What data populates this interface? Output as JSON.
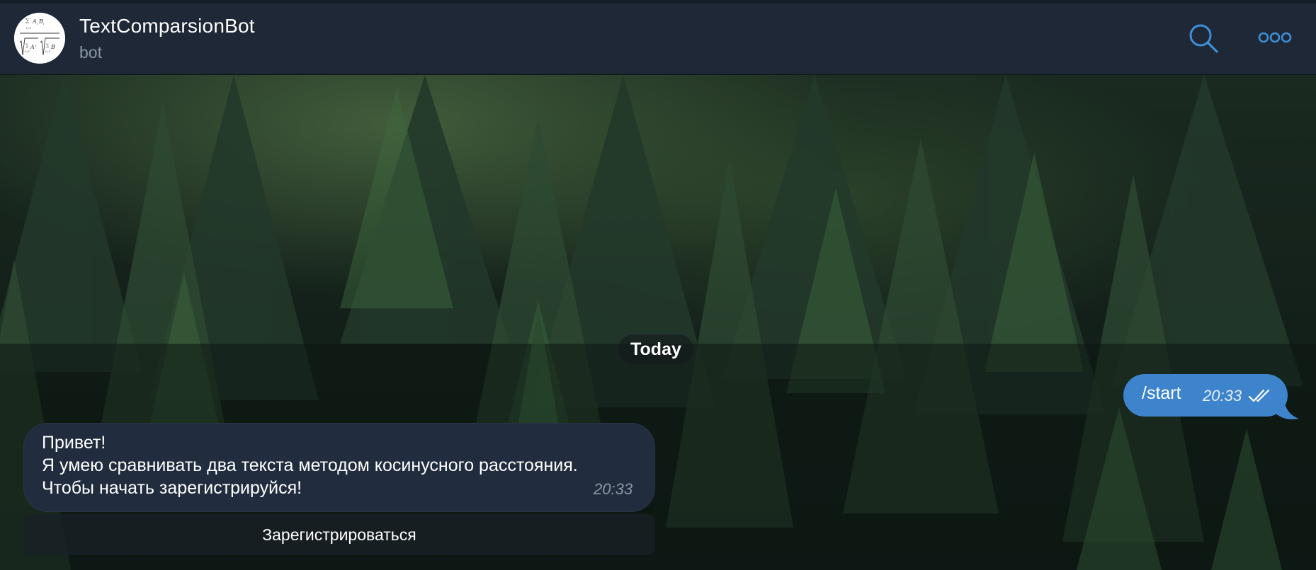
{
  "header": {
    "title": "TextComparsionBot",
    "status": "bot",
    "icons": [
      "bot-avatar",
      "search-icon",
      "more-icon"
    ]
  },
  "chat": {
    "date_label": "Today",
    "messages": [
      {
        "direction": "outgoing",
        "text": "/start",
        "time": "20:33",
        "status_icon": "double-check-icon"
      },
      {
        "direction": "incoming",
        "lines": [
          "Привет!",
          "Я умею сравнивать два текста методом косинусного расстояния.",
          "Чтобы начать зарегистрируйся!"
        ],
        "time": "20:33"
      }
    ],
    "inline_button": "Зарегистрироваться"
  },
  "colors": {
    "header_bg": "#1e2837",
    "accent": "#3e84cc",
    "outgoing_bubble": "#3e84cc",
    "incoming_bubble": "#212d3e",
    "muted_text": "#8c97a6"
  }
}
